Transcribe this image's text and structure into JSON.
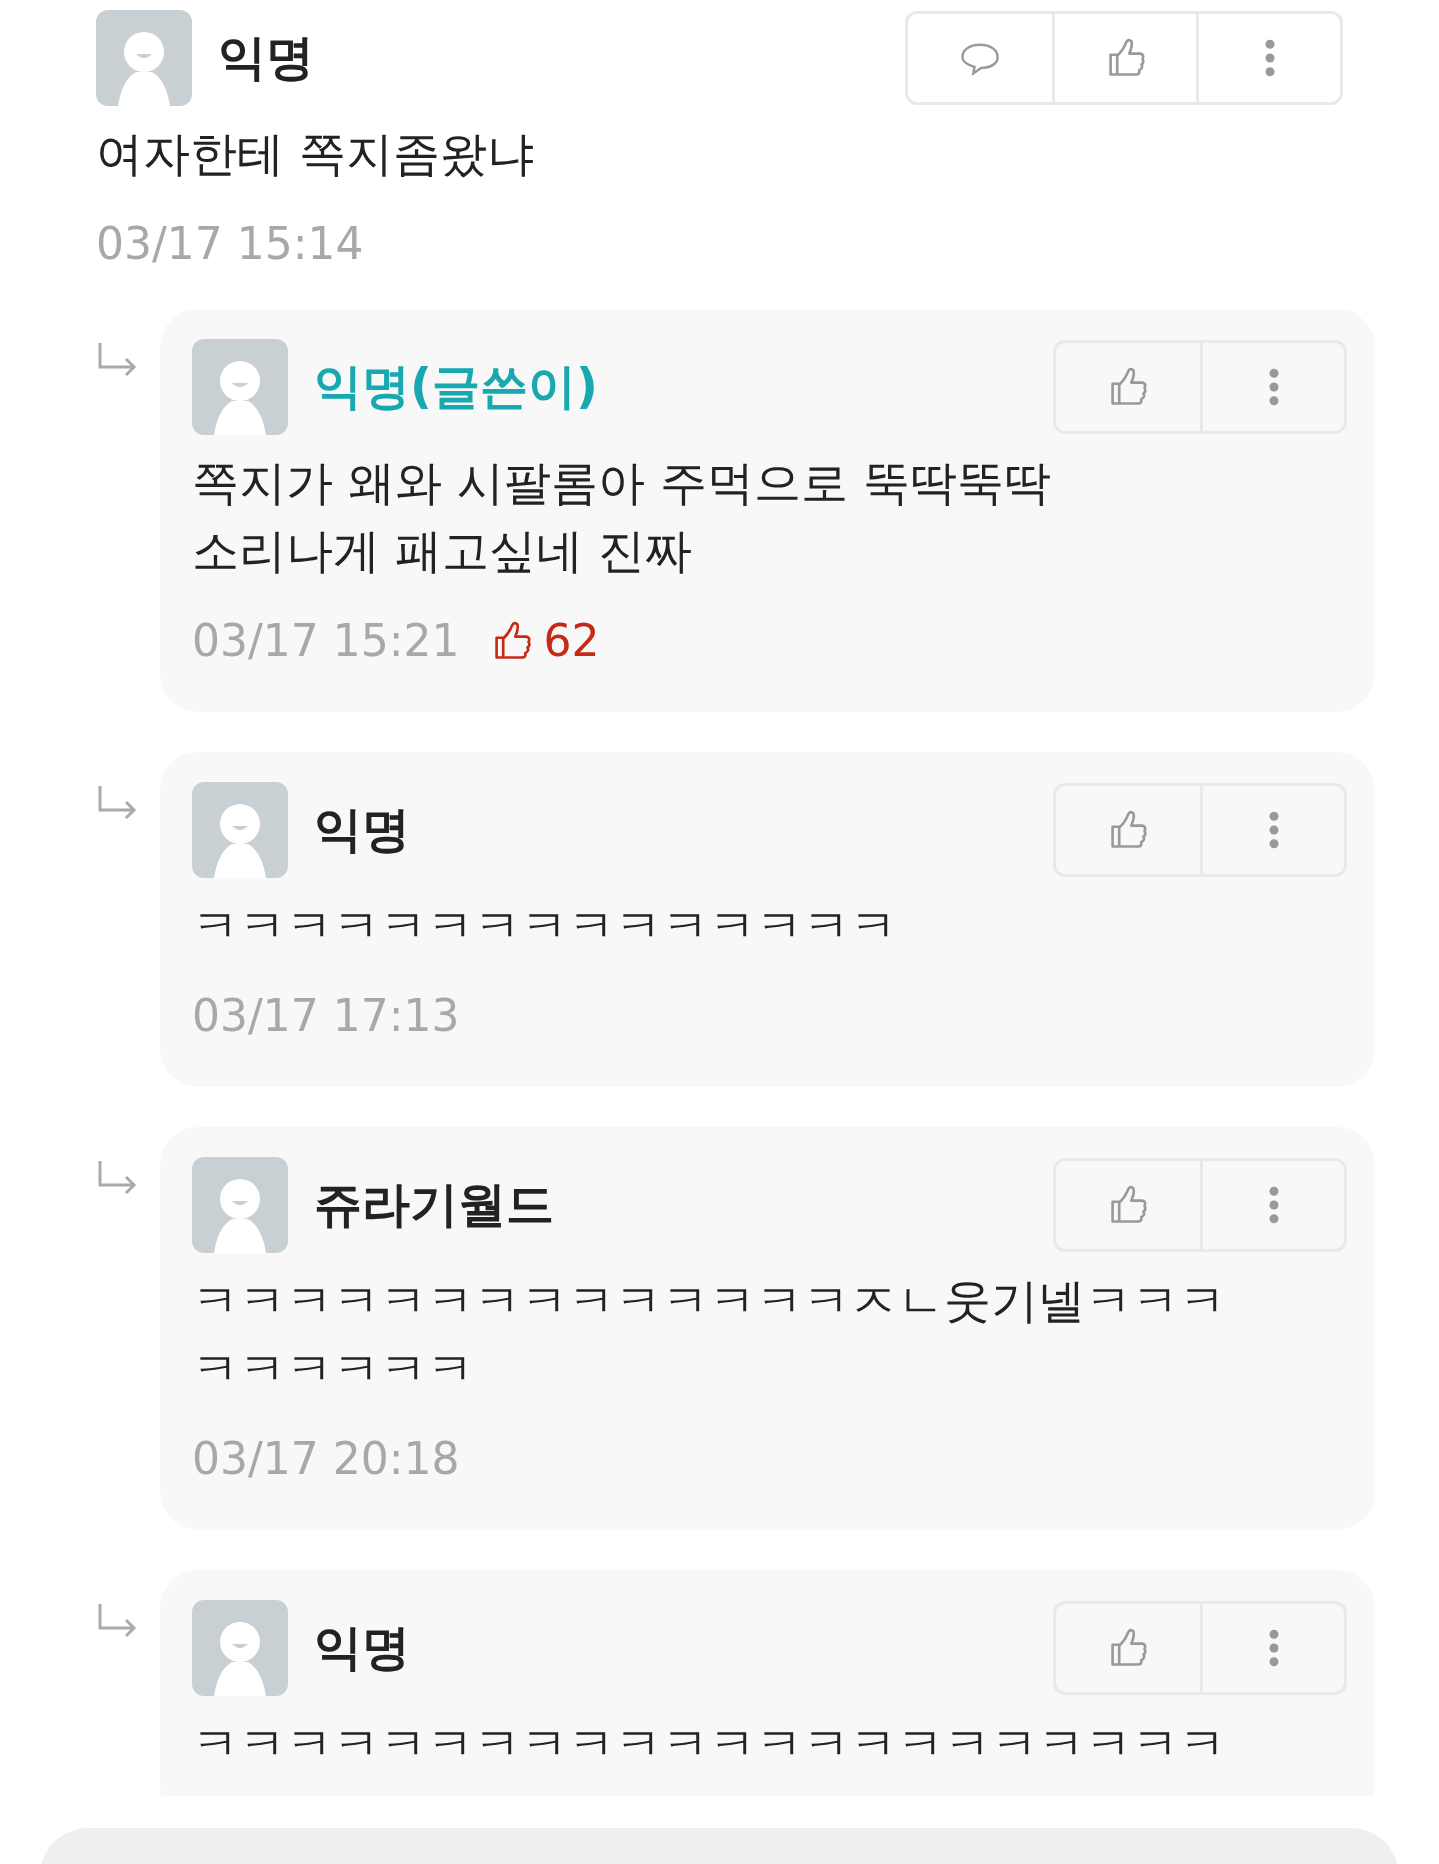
{
  "comment": {
    "author": "익명",
    "text": "여자한테 쪽지좀왔냐",
    "time": "03/17 15:14",
    "actions": [
      {
        "kind": "reply"
      },
      {
        "kind": "like"
      },
      {
        "kind": "more"
      }
    ]
  },
  "replies": [
    {
      "author": "익명(글쓴이)",
      "writer": true,
      "lines": [
        "쪽지가 왜와 시팔롬아 주먹으로 뚝딱뚝딱",
        "소리나게 패고싶네 진짜"
      ],
      "time": "03/17 15:21",
      "likes": "62",
      "actions": [
        {
          "kind": "like"
        },
        {
          "kind": "more"
        }
      ]
    },
    {
      "author": "익명",
      "writer": false,
      "lines": [
        "ㅋㅋㅋㅋㅋㅋㅋㅋㅋㅋㅋㅋㅋㅋㅋ"
      ],
      "time": "03/17 17:13",
      "actions": [
        {
          "kind": "like"
        },
        {
          "kind": "more"
        }
      ]
    },
    {
      "author": "쥬라기월드",
      "writer": false,
      "lines": [
        "ㅋㅋㅋㅋㅋㅋㅋㅋㅋㅋㅋㅋㅋㅋㅈㄴ웃기넬ㅋㅋㅋ",
        "ㅋㅋㅋㅋㅋㅋ"
      ],
      "time": "03/17 20:18",
      "actions": [
        {
          "kind": "like"
        },
        {
          "kind": "more"
        }
      ]
    },
    {
      "author": "익명",
      "writer": false,
      "lines": [
        "ㅋㅋㅋㅋㅋㅋㅋㅋㅋㅋㅋㅋㅋㅋㅋㅋㅋㅋㅋㅋㅋㅋ"
      ],
      "actions": [
        {
          "kind": "like"
        },
        {
          "kind": "more"
        }
      ]
    }
  ]
}
